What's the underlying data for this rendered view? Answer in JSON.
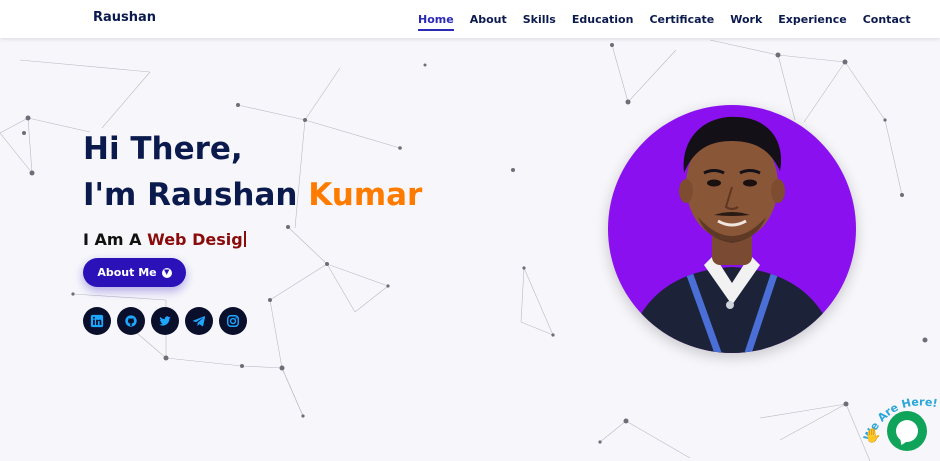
{
  "header": {
    "brand": "Raushan",
    "nav": [
      {
        "label": "Home",
        "active": true
      },
      {
        "label": "About",
        "active": false
      },
      {
        "label": "Skills",
        "active": false
      },
      {
        "label": "Education",
        "active": false
      },
      {
        "label": "Certificate",
        "active": false
      },
      {
        "label": "Work",
        "active": false
      },
      {
        "label": "Experience",
        "active": false
      },
      {
        "label": "Contact",
        "active": false
      }
    ]
  },
  "hero": {
    "greeting": "Hi There,",
    "intro_prefix": "I'm Raushan ",
    "intro_highlight": "Kumar",
    "role_prefix": "I Am A ",
    "role_typed": "Web Desig",
    "about_button": "About Me"
  },
  "socials": [
    {
      "icon": "linkedin-icon"
    },
    {
      "icon": "github-icon"
    },
    {
      "icon": "twitter-icon"
    },
    {
      "icon": "telegram-icon"
    },
    {
      "icon": "instagram-icon"
    }
  ],
  "chat_widget": {
    "tagline": "We Are Here!",
    "icon": "chat-bubble-icon"
  },
  "colors": {
    "navy": "#0b1a4d",
    "accent_orange": "#ff7b00",
    "typed_red": "#8b0a0a",
    "button_blue": "#2a12b8",
    "photo_purple": "#8a10ef",
    "chat_green": "#0fa45a"
  }
}
